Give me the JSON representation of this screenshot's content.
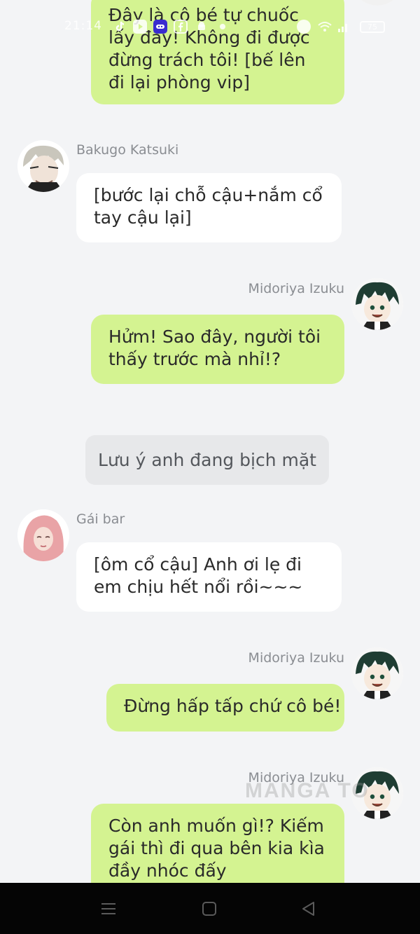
{
  "status_bar": {
    "time": "21:14",
    "battery": "75"
  },
  "messages": [
    {
      "sender": "",
      "text": "Đây là cô bé tự chuốc lấy đấy! Không đi được đừng trách tôi! [bế lên đi lại phòng vip]"
    },
    {
      "sender": "Bakugo Katsuki",
      "text": "[bước lại chỗ cậu+nắm cổ tay cậu lại]"
    },
    {
      "sender": "Midoriya Izuku",
      "text": "Hửm! Sao đây, người tôi thấy trước mà nhỉ!?"
    },
    {
      "notice": "Lưu ý anh đang bịch mặt"
    },
    {
      "sender": "Gái bar",
      "text": "[ôm cổ cậu] Anh ơi lẹ đi em chịu hết nổi rồi~~~"
    },
    {
      "sender": "Midoriya Izuku",
      "text": "Đừng hấp tấp chứ cô bé!"
    },
    {
      "sender": "Midoriya Izuku",
      "text": "Còn anh muốn gì!? Kiếm gái thì đi qua bên kia kìa đầy nhóc đấy"
    }
  ],
  "watermark": "MANGA TO",
  "colors": {
    "background": "#f3f4f6",
    "my_bubble": "#d4f391",
    "their_bubble": "#ffffff",
    "notice_bubble": "#e7e8ea",
    "name_text": "#8a8d92"
  }
}
